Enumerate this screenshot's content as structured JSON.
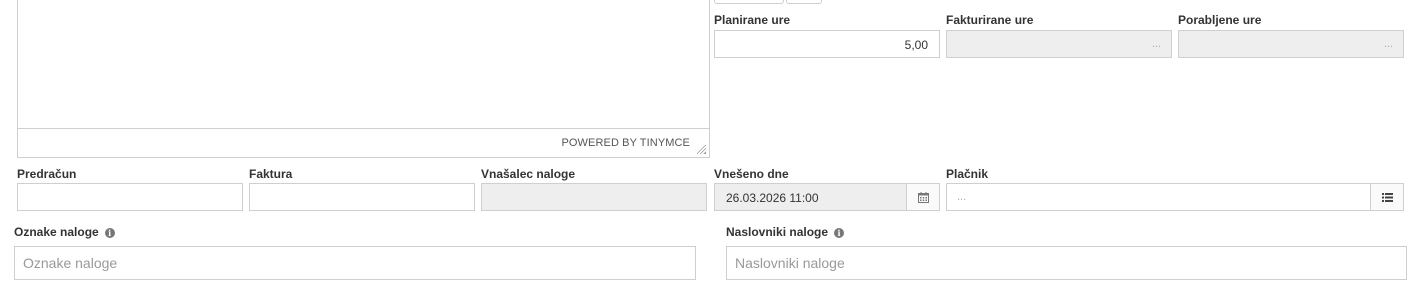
{
  "editor": {
    "powered_by": "POWERED BY TINYMCE"
  },
  "hours": {
    "planned": {
      "label": "Planirane ure",
      "value": "5,00"
    },
    "invoiced": {
      "label": "Fakturirane ure",
      "value": "..."
    },
    "consumed": {
      "label": "Porabljene ure",
      "value": "..."
    }
  },
  "row2": {
    "estimate": {
      "label": "Predračun",
      "value": ""
    },
    "invoice": {
      "label": "Faktura",
      "value": ""
    },
    "creator": {
      "label": "Vnašalec naloge",
      "value": ""
    },
    "entered": {
      "label": "Vnešeno dne",
      "value": "26.03.2026 11:00"
    },
    "payer": {
      "label": "Plačnik",
      "value": "..."
    }
  },
  "tags": {
    "label": "Oznake naloge",
    "placeholder": "Oznake naloge"
  },
  "recipients": {
    "label": "Naslovniki naloge",
    "placeholder": "Naslovniki naloge"
  }
}
